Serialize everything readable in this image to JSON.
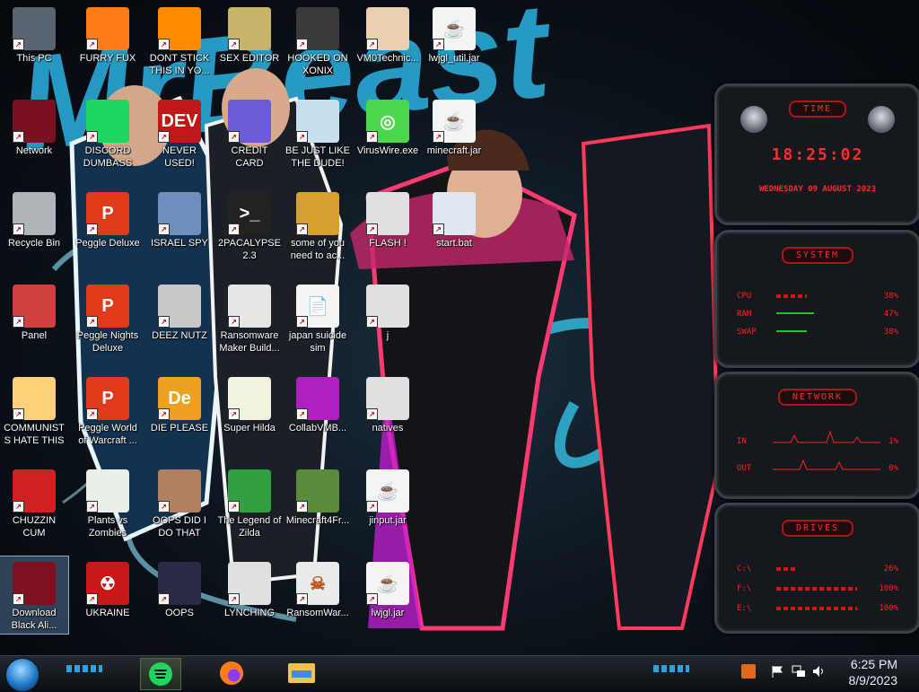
{
  "desktop": {
    "icons": [
      {
        "label": "This PC",
        "icon": "this-pc-icon",
        "selected": false
      },
      {
        "label": "FURRY FUX",
        "icon": "firefox-icon",
        "selected": false
      },
      {
        "label": "DONT STICK THIS IN YO...",
        "icon": "vlc-icon",
        "selected": false
      },
      {
        "label": "SEX EDITOR",
        "icon": "hex-editor-icon",
        "selected": false
      },
      {
        "label": "HOOKED ON XONIX",
        "icon": "xonix-game-icon",
        "selected": false
      },
      {
        "label": "VM0Technic...",
        "icon": "doctor-icon",
        "selected": false
      },
      {
        "label": "lwjgl_util.jar",
        "icon": "java-jar-icon",
        "selected": false
      },
      {
        "label": "Network",
        "icon": "network-icon",
        "selected": false
      },
      {
        "label": "DISCORD DUMBASS",
        "icon": "spotify-icon",
        "selected": false
      },
      {
        "label": "NEVER USED!",
        "icon": "devcpp-icon",
        "selected": false
      },
      {
        "label": "CREDIT CARD CHECKER",
        "icon": "credit-card-icon",
        "selected": false
      },
      {
        "label": "BE JUST LIKE THE DUDE!",
        "icon": "santa-icon",
        "selected": false
      },
      {
        "label": "VirusWire.exe",
        "icon": "limewire-icon",
        "selected": false
      },
      {
        "label": "minecraft.jar",
        "icon": "java-jar-icon",
        "selected": false
      },
      {
        "label": "Recycle Bin",
        "icon": "recycle-bin-icon",
        "selected": false
      },
      {
        "label": "Peggle Deluxe",
        "icon": "peggle-icon",
        "selected": false
      },
      {
        "label": "ISRAEL SPY",
        "icon": "network-card-icon",
        "selected": false
      },
      {
        "label": "2PACALYPSE 2.3",
        "icon": "terminal-icon",
        "selected": false
      },
      {
        "label": "some of you need to ac...",
        "icon": "beaver-icon",
        "selected": false
      },
      {
        "label": "FLASH !",
        "icon": "folder-icon",
        "selected": false
      },
      {
        "label": "start.bat",
        "icon": "batch-file-icon",
        "selected": false
      },
      {
        "label": "Panel",
        "icon": "control-panel-icon",
        "selected": false
      },
      {
        "label": "Peggle Nights Deluxe",
        "icon": "peggle-icon",
        "selected": false
      },
      {
        "label": "DEEZ NUTZ",
        "icon": "windows-stack-icon",
        "selected": false
      },
      {
        "label": "Ransomware Maker Build...",
        "icon": "app-window-icon",
        "selected": false
      },
      {
        "label": "japan suicide sim",
        "icon": "document-icon",
        "selected": false
      },
      {
        "label": "j",
        "icon": "folder-icon",
        "selected": false
      },
      {
        "label": "COMMUNISTS HATE THIS G...",
        "icon": "star-butterfly-icon",
        "selected": false
      },
      {
        "label": "Peggle World of Warcraft ...",
        "icon": "peggle-icon",
        "selected": false
      },
      {
        "label": "DIE PLEASE",
        "icon": "die-icon",
        "selected": false
      },
      {
        "label": "Super Hilda",
        "icon": "pixel-game-icon",
        "selected": false
      },
      {
        "label": "CollabVMB...",
        "icon": "collabvm-icon",
        "selected": false
      },
      {
        "label": "natives",
        "icon": "folder-icon",
        "selected": false
      },
      {
        "label": "CHUZZIN CUM",
        "icon": "chuzzle-icon",
        "selected": false
      },
      {
        "label": "Plants vs Zombies",
        "icon": "plants-vs-zombies-icon",
        "selected": false
      },
      {
        "label": "OOPS DID I DO THAT",
        "icon": "portrait-icon",
        "selected": false
      },
      {
        "label": "The Legend of Zilda",
        "icon": "zelda-icon",
        "selected": false
      },
      {
        "label": "Minecraft4Fr...",
        "icon": "minecraft-icon",
        "selected": false
      },
      {
        "label": "jinput.jar",
        "icon": "java-jar-icon",
        "selected": false
      },
      {
        "label": "Download Black Ali...",
        "icon": "alienware-icon",
        "selected": true
      },
      {
        "label": "UKRAINE",
        "icon": "radiation-icon",
        "selected": false
      },
      {
        "label": "OOPS",
        "icon": "monitor-icon",
        "selected": false
      },
      {
        "label": "LYNCHING",
        "icon": "noose-icon",
        "selected": false
      },
      {
        "label": "RansomWar...",
        "icon": "skull-icon",
        "selected": false
      },
      {
        "label": "lwjgl.jar",
        "icon": "java-jar-icon",
        "selected": false
      }
    ]
  },
  "widgets": {
    "clock": {
      "title": "TIME",
      "time": "18:25:02",
      "date": "WEDNESDAY 09 AUGUST 2023"
    },
    "system": {
      "title": "SYSTEM",
      "rows": [
        {
          "label": "CPU",
          "value": "38%",
          "fill": 0.38
        },
        {
          "label": "RAM",
          "value": "47%",
          "fill": 0.47
        },
        {
          "label": "SWAP",
          "value": "38%",
          "fill": 0.38
        }
      ]
    },
    "network": {
      "title": "NETWORK",
      "rows": [
        {
          "label": "IN",
          "value": "1%"
        },
        {
          "label": "OUT",
          "value": "0%"
        }
      ]
    },
    "drives": {
      "title": "DRIVES",
      "rows": [
        {
          "label": "C:\\",
          "value": "26%",
          "fill": 0.26
        },
        {
          "label": "F:\\",
          "value": "100%",
          "fill": 1.0
        },
        {
          "label": "E:\\",
          "value": "100%",
          "fill": 1.0
        }
      ]
    }
  },
  "wallpaper": {
    "text": "MrBeast"
  },
  "taskbar": {
    "apps": [
      {
        "name": "spotify-icon",
        "active": true
      },
      {
        "name": "firefox-icon",
        "active": false
      },
      {
        "name": "file-explorer-icon",
        "active": false
      }
    ],
    "tray": {
      "time": "6:25 PM",
      "date": "8/9/2023"
    }
  },
  "colors": {
    "widget_red": "#ff2020",
    "accent_cyan": "#2fb9ff"
  }
}
